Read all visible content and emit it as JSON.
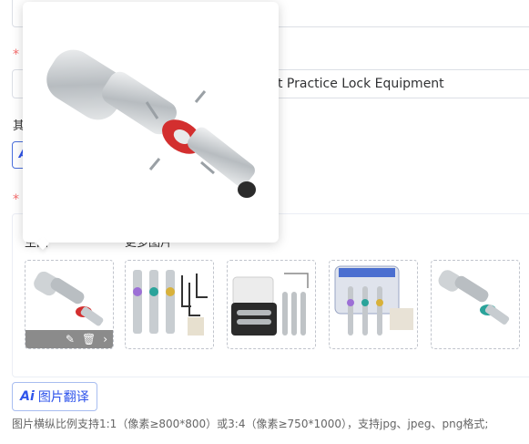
{
  "product_title": {
    "value": "kit Practice Lock Equipment"
  },
  "other_label": "其",
  "ai_label": "Ai",
  "image_panel": {
    "main_label": "主图",
    "more_label": "更多图片"
  },
  "thumbnails": [
    {
      "name": "single-tension-tool",
      "accent": "#d32f2f"
    },
    {
      "name": "three-picks-with-wrenches",
      "accent": "#9c6fd6"
    },
    {
      "name": "tool-case-with-picks",
      "accent": "#888888"
    },
    {
      "name": "boxed-pick-set",
      "accent": "#4b6fd0"
    },
    {
      "name": "single-tool-green",
      "accent": "#2aa39a"
    }
  ],
  "thumb_actions": {
    "edit": "✎",
    "delete": "🗑",
    "next": "›"
  },
  "translate_button": {
    "ai": "Ai",
    "label": "图片翻译"
  },
  "hint_text": "图片横纵比例支持1:1（像素≥800*800）或3:4（像素≥750*1000），支持jpg、jpeg、png格式;",
  "colors": {
    "required": "#f56c6c",
    "accent_blue": "#2f54eb"
  }
}
